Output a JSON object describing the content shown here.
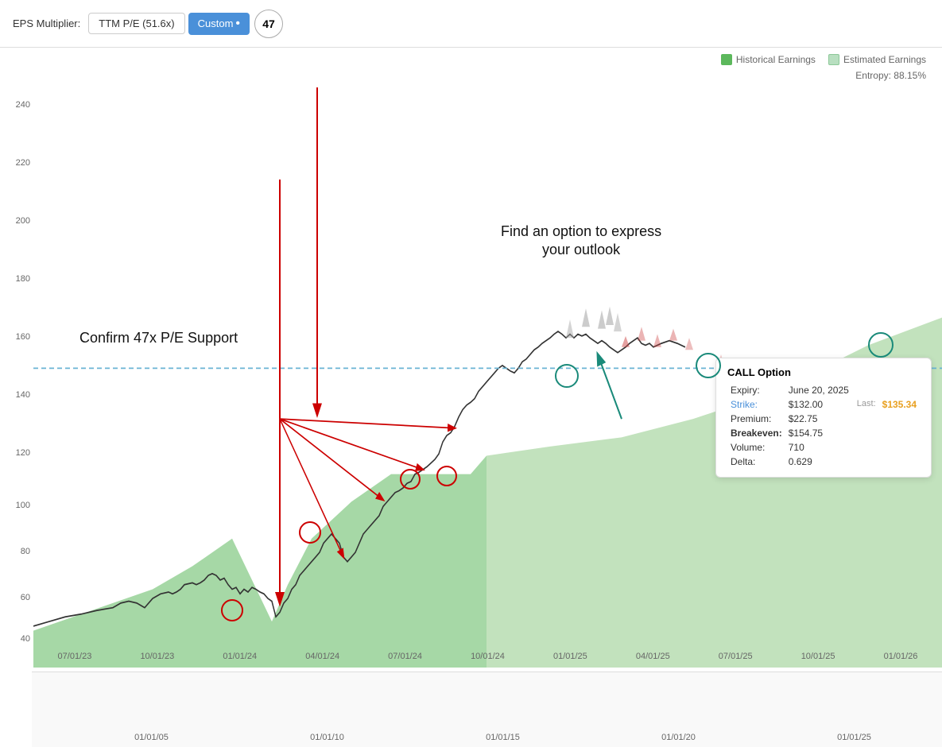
{
  "topbar": {
    "eps_label": "EPS Multiplier:",
    "ttm_btn": "TTM P/E (51.6x)",
    "custom_btn": "Custom",
    "custom_value": "47"
  },
  "legend": {
    "historical_label": "Historical Earnings",
    "estimated_label": "Estimated Earnings"
  },
  "entropy": "Entropy: 88.15%",
  "annotation_confirm": "Confirm 47x P/E Support",
  "annotation_find_line1": "Find an option to express",
  "annotation_find_line2": "your outlook",
  "option_card": {
    "title": "CALL Option",
    "expiry_label": "Expiry:",
    "expiry_val": "June 20, 2025",
    "strike_label": "Strike:",
    "strike_val": "$132.00",
    "last_label": "Last:",
    "last_val": "$135.34",
    "premium_label": "Premium:",
    "premium_val": "$22.75",
    "breakeven_label": "Breakeven:",
    "breakeven_val": "$154.75",
    "volume_label": "Volume:",
    "volume_val": "710",
    "delta_label": "Delta:",
    "delta_val": "0.629"
  },
  "y_axis": {
    "labels": [
      "240",
      "220",
      "200",
      "180",
      "160",
      "140",
      "120",
      "100",
      "80",
      "60",
      "40"
    ]
  },
  "x_axis_main": {
    "labels": [
      "07/01/23",
      "10/01/23",
      "01/01/24",
      "04/01/24",
      "07/01/24",
      "10/01/24",
      "01/01/25",
      "04/01/25",
      "07/01/25",
      "10/01/25",
      "01/01/26"
    ]
  },
  "x_axis_nav": {
    "labels": [
      "01/01/05",
      "01/01/10",
      "01/01/15",
      "01/01/20",
      "01/01/25"
    ]
  }
}
